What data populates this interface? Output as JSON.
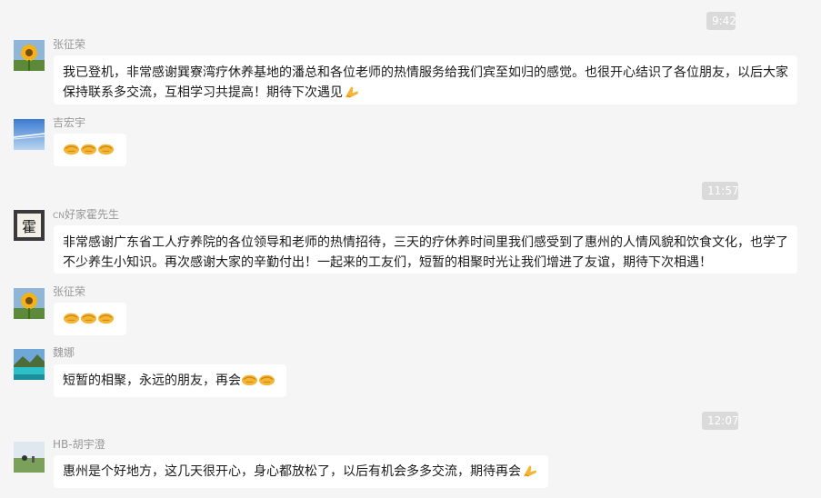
{
  "timestamps": [
    "9:42",
    "11:57",
    "12:07"
  ],
  "messages": [
    {
      "sender": "张征荣",
      "text": "我已登机，非常感谢巽寮湾疗休养基地的潘总和各位老师的热情服务给我们宾至如归的感觉。也很开心结识了各位朋友，以后大家保持联系多交流，互相学习共提高！期待下次遇见",
      "emoji": [
        "pray-emoji"
      ]
    },
    {
      "sender": "吉宏宇",
      "text": "",
      "emoji": [
        "handshake-emoji",
        "handshake-emoji",
        "handshake-emoji"
      ]
    },
    {
      "sender_prefix": "CN",
      "sender": "好家霍先生",
      "avatar_char": "霍",
      "text": "非常感谢广东省工人疗养院的各位领导和老师的热情招待，三天的疗休养时间里我们感受到了惠州的人情风貌和饮食文化，也学了不少养生小知识。再次感谢大家的辛勤付出！一起来的工友们，短暂的相聚时光让我们增进了友谊，期待下次相遇！",
      "emoji": []
    },
    {
      "sender": "张征荣",
      "text": "",
      "emoji": [
        "handshake-emoji",
        "handshake-emoji",
        "handshake-emoji"
      ]
    },
    {
      "sender": "魏娜",
      "text": "短暂的相聚，永远的朋友，再会",
      "emoji": [
        "handshake-emoji",
        "handshake-emoji"
      ]
    },
    {
      "sender": "HB-胡宇澄",
      "text": "惠州是个好地方，这几天很开心，身心都放松了，以后有机会多多交流，期待再会",
      "emoji": [
        "pray-emoji"
      ]
    }
  ],
  "colors": {
    "background": "#f5f5f5",
    "bubble": "#ffffff",
    "timestamp_bg": "#dadada",
    "sender_name": "#999999"
  }
}
